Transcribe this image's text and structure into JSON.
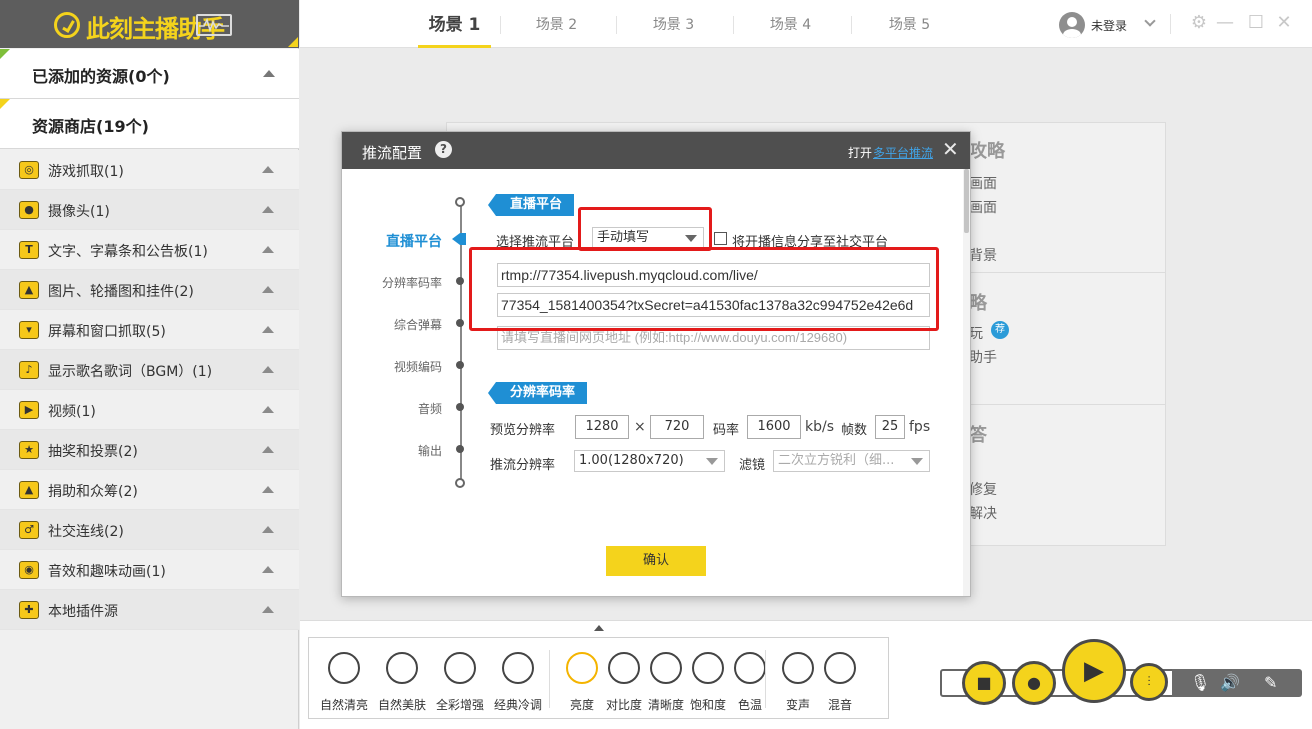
{
  "logo": {
    "text": "此刻主播助手"
  },
  "left_panel": {
    "added_header": "已添加的资源(0个)",
    "store_header": "资源商店(19个)",
    "categories": [
      {
        "label": "游戏抓取(1)",
        "icon": "gamepad-icon",
        "glyph": "◎"
      },
      {
        "label": "摄像头(1)",
        "icon": "webcam-icon",
        "glyph": "●"
      },
      {
        "label": "文字、字幕条和公告板(1)",
        "icon": "text-icon",
        "glyph": "T"
      },
      {
        "label": "图片、轮播图和挂件(2)",
        "icon": "image-icon",
        "glyph": "▲"
      },
      {
        "label": "屏幕和窗口抓取(5)",
        "icon": "screen-capture-icon",
        "glyph": "▾"
      },
      {
        "label": "显示歌名歌词（BGM）(1)",
        "icon": "bgm-icon",
        "glyph": "♪"
      },
      {
        "label": "视频(1)",
        "icon": "video-icon",
        "glyph": "▶"
      },
      {
        "label": "抽奖和投票(2)",
        "icon": "lottery-icon",
        "glyph": "★"
      },
      {
        "label": "捐助和众筹(2)",
        "icon": "donate-icon",
        "glyph": "▲"
      },
      {
        "label": "社交连线(2)",
        "icon": "social-icon",
        "glyph": "♂"
      },
      {
        "label": "音效和趣味动画(1)",
        "icon": "sound-effect-icon",
        "glyph": "◉"
      },
      {
        "label": "本地插件源",
        "icon": "plugin-icon",
        "glyph": "✚"
      }
    ]
  },
  "topbar": {
    "tabs": [
      "场景 1",
      "场景 2",
      "场景 3",
      "场景 4",
      "场景 5"
    ],
    "active_tab": 0,
    "login_label": "未登录"
  },
  "background_panel": {
    "col1_head": "攻略",
    "col1_items": [
      "画面",
      "画面",
      "背景"
    ],
    "col2_head": "略",
    "col2_items": [
      "玩",
      "助手"
    ],
    "col2_badge": "荐",
    "col3_head": "答",
    "col3_items": [
      "修复",
      "解决"
    ]
  },
  "dialog": {
    "title": "推流配置",
    "open_label": "打开",
    "multi_link": "多平台推流",
    "nav": [
      "直播平台",
      "分辨率码率",
      "综合弹幕",
      "视频编码",
      "音频",
      "输出"
    ],
    "section_platform": "直播平台",
    "select_platform_label": "选择推流平台",
    "platform_value": "手动填写",
    "share_label": "将开播信息分享至社交平台",
    "rtmp_url": "rtmp://77354.livepush.myqcloud.com/live/",
    "stream_key": "77354_1581400354?txSecret=a41530fac1378a32c994752e42e6d",
    "page_url_placeholder": "请填写直播间网页地址 (例如:http://www.douyu.com/129680)",
    "section_resolution": "分辨率码率",
    "preview_res_label": "预览分辨率",
    "preview_w": "1280",
    "times": "×",
    "preview_h": "720",
    "bitrate_label": "码率",
    "bitrate": "1600",
    "bitrate_unit": "kb/s",
    "fps_label": "帧数",
    "fps": "25",
    "fps_unit": "fps",
    "push_res_label": "推流分辨率",
    "push_res_value": "1.00(1280x720)",
    "filter_label": "滤镜",
    "filter_value": "二次立方锐利（细...",
    "confirm": "确认"
  },
  "bottom_filters": {
    "beauty": [
      "自然清亮",
      "自然美肤",
      "全彩增强",
      "经典冷调"
    ],
    "adjust": [
      "亮度",
      "对比度",
      "清晰度",
      "饱和度",
      "色温"
    ],
    "audio": [
      "变声",
      "混音"
    ]
  },
  "colors": {
    "accent": "#f4d31c",
    "link": "#1f8fd4",
    "highlight": "#e31a1a",
    "header_dark": "#4f4f4f"
  }
}
